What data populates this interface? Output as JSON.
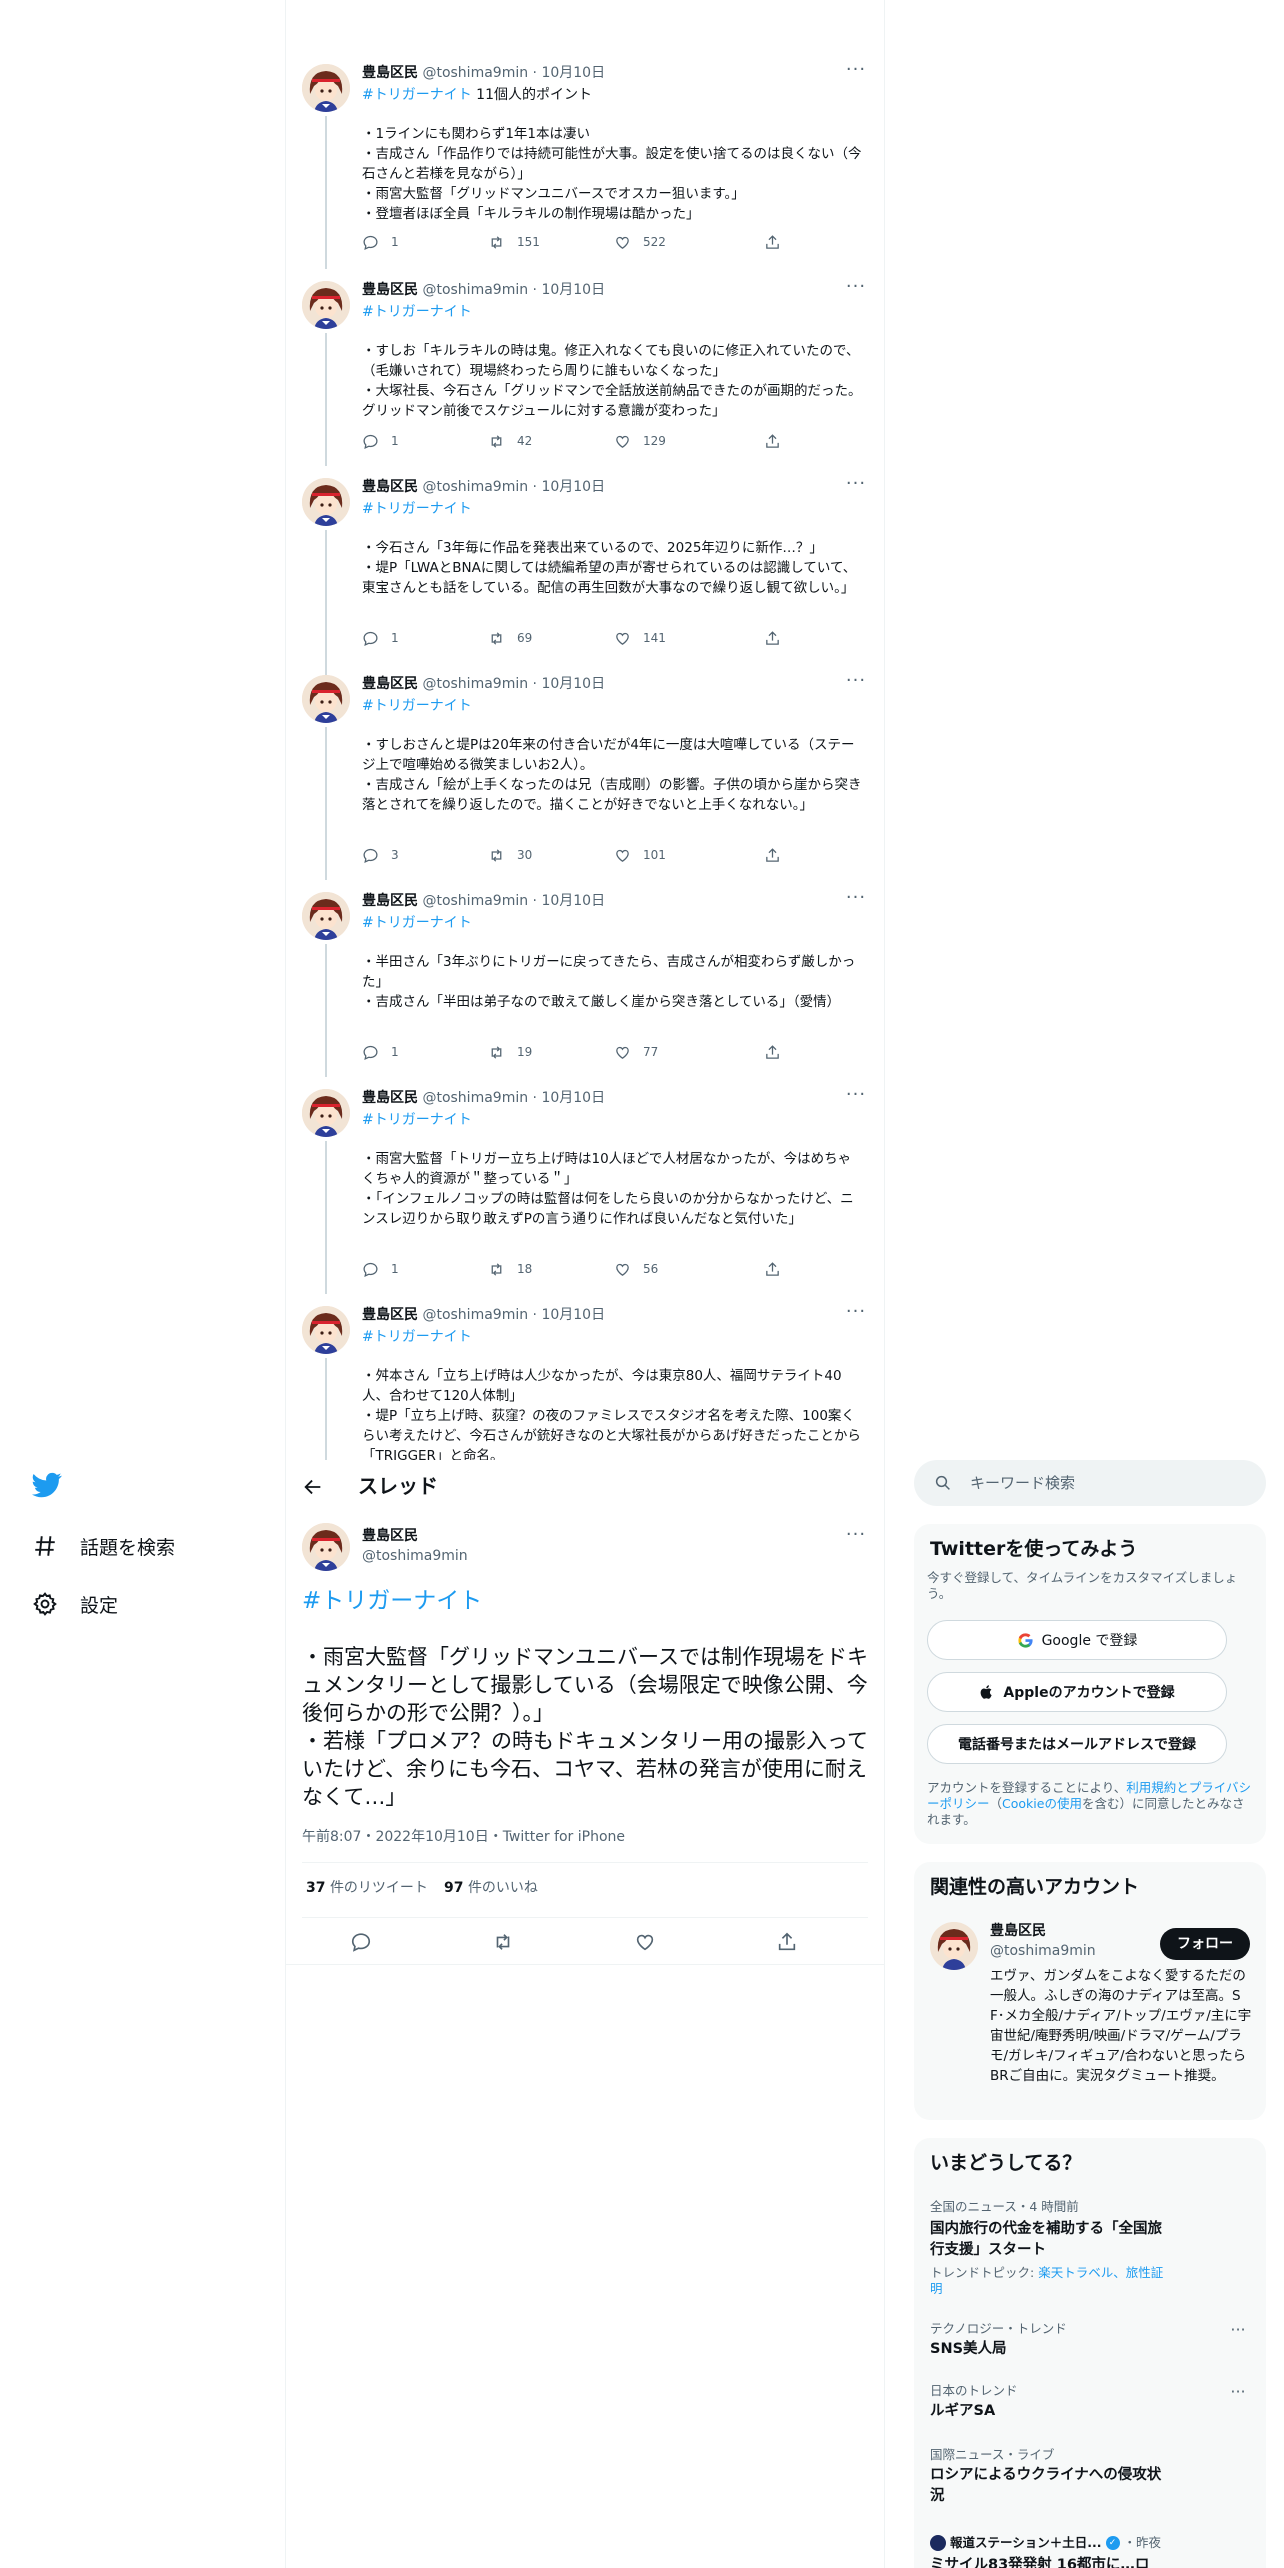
{
  "author": {
    "name": "豊島区民",
    "handle": "@toshima9min"
  },
  "thread": [
    {
      "date": "10月10日",
      "hashtag": "#トリガーナイト",
      "hashtag_extra": " 11個人的ポイント",
      "text": "・1ラインにも関わらず1年1本は凄い\n・吉成さん「作品作りでは持続可能性が大事。設定を使い捨てるのは良くない（今石さんと若様を見ながら）」\n・雨宮大監督「グリッドマンユニバースでオスカー狙います。」\n・登壇者ほぼ全員「キルラキルの制作現場は酷かった」",
      "replies": "1",
      "retweets": "151",
      "likes": "522"
    },
    {
      "date": "10月10日",
      "hashtag": "#トリガーナイト",
      "hashtag_extra": "",
      "text": "・すしお「キルラキルの時は鬼。修正入れなくても良いのに修正入れていたので、（毛嫌いされて）現場終わったら周りに誰もいなくなった」\n・大塚社長、今石さん「グリッドマンで全話放送前納品できたのが画期的だった。グリッドマン前後でスケジュールに対する意識が変わった」",
      "replies": "1",
      "retweets": "42",
      "likes": "129"
    },
    {
      "date": "10月10日",
      "hashtag": "#トリガーナイト",
      "hashtag_extra": "",
      "text": "・今石さん「3年毎に作品を発表出来ているので、2025年辺りに新作…？」\n・堤P「LWAとBNAに関しては続編希望の声が寄せられているのは認識していて、東宝さんとも話をしている。配信の再生回数が大事なので繰り返し観て欲しい。」",
      "replies": "1",
      "retweets": "69",
      "likes": "141"
    },
    {
      "date": "10月10日",
      "hashtag": "#トリガーナイト",
      "hashtag_extra": "",
      "text": "・すしおさんと堤Pは20年来の付き合いだが4年に一度は大喧嘩している（ステージ上で喧嘩始める微笑ましいお2人）。\n・吉成さん「絵が上手くなったのは兄（吉成剛）の影響。子供の頃から崖から突き落とされてを繰り返したので。描くことが好きでないと上手くなれない。」",
      "replies": "3",
      "retweets": "30",
      "likes": "101"
    },
    {
      "date": "10月10日",
      "hashtag": "#トリガーナイト",
      "hashtag_extra": "",
      "text": "・半田さん「3年ぶりにトリガーに戻ってきたら、吉成さんが相変わらず厳しかった」\n・吉成さん「半田は弟子なので敢えて厳しく崖から突き落としている」（愛情）",
      "replies": "1",
      "retweets": "19",
      "likes": "77"
    },
    {
      "date": "10月10日",
      "hashtag": "#トリガーナイト",
      "hashtag_extra": "",
      "text": "・雨宮大監督「トリガー立ち上げ時は10人ほどで人材居なかったが、今はめちゃくちゃ人的資源が＂整っている＂」\n・「インフェルノコップの時は監督は何をしたら良いのか分からなかったけど、ニンスレ辺りから取り敢えずPの言う通りに作れば良いんだなと気付いた」",
      "replies": "1",
      "retweets": "18",
      "likes": "56"
    },
    {
      "date": "10月10日",
      "hashtag": "#トリガーナイト",
      "hashtag_extra": "",
      "text": "・舛本さん「立ち上げ時は人少なかったが、今は東京80人、福岡サテライト40人、合わせて120人体制」\n・堤P「立ち上げ時、荻窪？の夜のファミレスでスタジオ名を考えた際、100案くらい考えたけど、今石さんが銃好きなのと大塚社長がからあげ好きだったことから「TRIGGER」と命名。",
      "replies": "",
      "retweets": "",
      "likes": ""
    }
  ],
  "sidebar": {
    "explore_label": "話題を検索",
    "settings_label": "設定"
  },
  "header": {
    "title": "スレッド"
  },
  "focus": {
    "hashtag": "#トリガーナイト",
    "text": "・雨宮大監督「グリッドマンユニバースでは制作現場をドキュメンタリーとして撮影している（会場限定で映像公開、今後何らかの形で公開？）。」\n・若様「プロメア？の時もドキュメンタリー用の撮影入っていたけど、余りにも今石、コヤマ、若林の発言が使用に耐えなくて…」",
    "meta": "午前8:07・2022年10月10日・Twitter for iPhone",
    "retweet_count": "37",
    "retweet_label": "件のリツイート",
    "like_count": "97",
    "like_label": "件のいいね"
  },
  "search": {
    "placeholder": "キーワード検索"
  },
  "signup": {
    "title": "Twitterを使ってみよう",
    "desc": "今すぐ登録して、タイムラインをカスタマイズしましょう。",
    "google": "Google で登録",
    "apple": "Appleのアカウントで登録",
    "phone": "電話番号またはメールアドレスで登録",
    "legal_1": "アカウントを登録することにより、",
    "legal_link_1": "利用規約とプライバシーポリシー",
    "legal_2": "（",
    "legal_link_2": "Cookieの使用",
    "legal_3": "を含む）に同意したとみなされます。"
  },
  "related": {
    "title": "関連性の高いアカウント",
    "name": "豊島区民",
    "handle": "@toshima9min",
    "follow_label": "フォロー",
    "bio": "エヴァ、ガンダムをこよなく愛するただの一般人。ふしぎの海のナディアは至高。SF･メカ全般/ナディア/トップ/エヴァ/主に宇宙世紀/庵野秀明/映画/ドラマ/ゲーム/プラモ/ガレキ/フィギュア/合わないと思ったらBRご自由に。実況タグミュート推奨。"
  },
  "trends": {
    "title": "いまどうしてる？",
    "items": [
      {
        "category": "全国のニュース・4 時間前",
        "title": "国内旅行の代金を補助する「全国旅行支援」スタート",
        "sub_prefix": "トレンドトピック: ",
        "sub_links": "楽天トラベル、旅性証明"
      },
      {
        "category": "テクノロジー・トレンド",
        "title": "SNS美人局"
      },
      {
        "category": "日本のトレンド",
        "title": "ルギアSA"
      },
      {
        "category": "国際ニュース・ライブ",
        "title": "ロシアによるウクライナへの侵攻状況"
      },
      {
        "category": "報道ステーション＋土日...",
        "time": "・昨夜",
        "title": "ミサイル83発発射 16都市に…ロ"
      }
    ]
  },
  "colors": {
    "accent": "#1d9bf0",
    "text": "#0f1419",
    "muted": "#536471",
    "border": "#eff3f4"
  }
}
